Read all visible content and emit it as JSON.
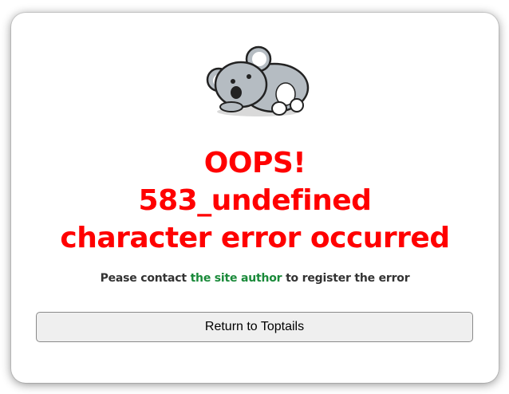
{
  "dialog": {
    "headline_line1": "OOPS!",
    "headline_line2": "583_undefined",
    "headline_line3": "character error occurred",
    "message_before": "Pease contact ",
    "message_link": "the site author",
    "message_after": " to register the error",
    "return_button_label": "Return to Toptails"
  },
  "colors": {
    "headline": "#ff0000",
    "link": "#1a8a3a",
    "message_text": "#333333",
    "button_bg": "#efefef"
  },
  "icons": {
    "mascot": "koala-lying-down-illustration"
  }
}
